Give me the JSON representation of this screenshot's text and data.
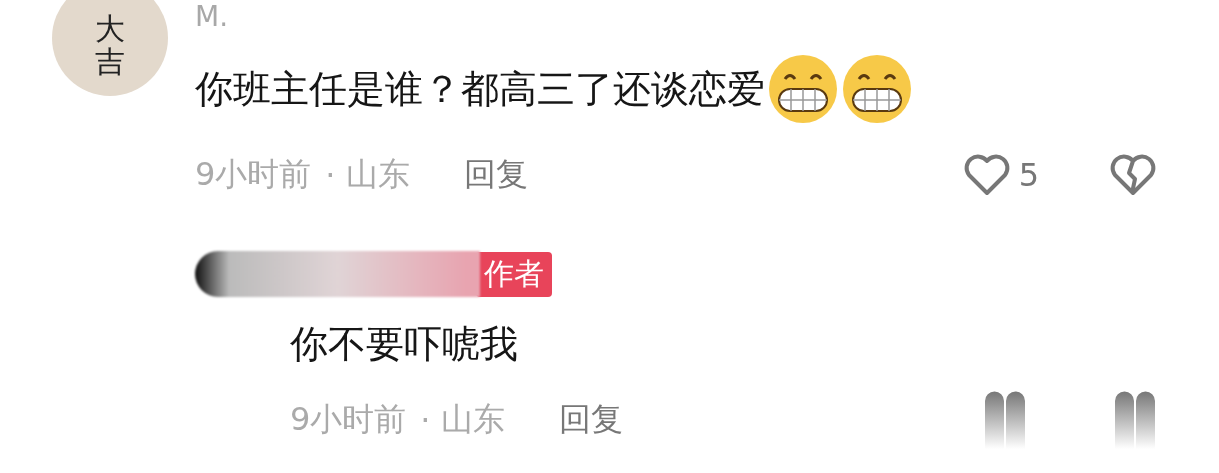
{
  "comment": {
    "avatar_text": "大吉",
    "username": "M.",
    "text": "你班主任是谁？都高三了还谈恋爱",
    "emojis": [
      {
        "kind": "grin"
      },
      {
        "kind": "grin"
      }
    ],
    "time": "9小时前",
    "separator": "·",
    "location": "山东",
    "reply_label": "回复",
    "likes": "5",
    "liked": false
  },
  "reply": {
    "username_blurred": true,
    "tag": "作者",
    "text": "你不要吓唬我",
    "time": "9小时前",
    "separator": "·",
    "location": "山东",
    "reply_label": "回复"
  }
}
